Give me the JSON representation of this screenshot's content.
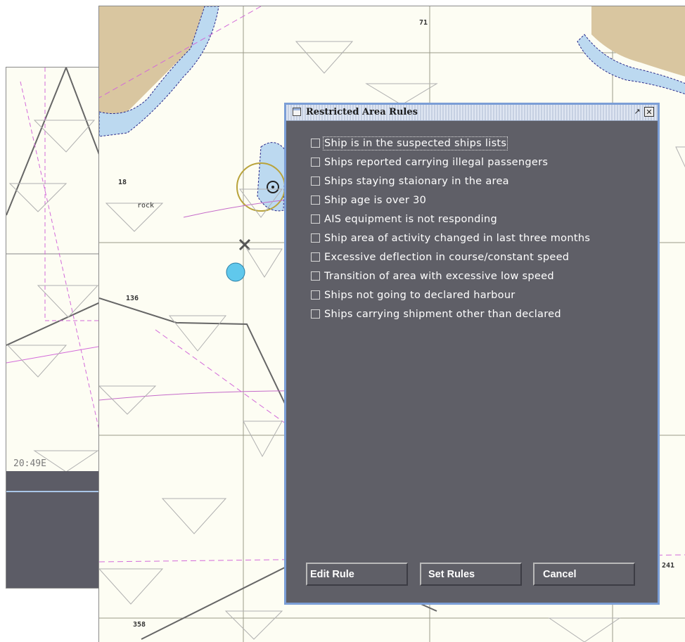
{
  "background": {
    "left_panel": {
      "coordinate_label": "20:49E"
    },
    "map": {
      "depth_labels": [
        "71",
        "136",
        "241",
        "358",
        "18",
        "rock"
      ]
    }
  },
  "dialog": {
    "title": "Restricted Area Rules",
    "icons": {
      "window": "window-icon",
      "restore": "restore-icon",
      "close": "close-icon"
    },
    "rules": [
      {
        "label": "Ship is in the suspected ships lists",
        "checked": false,
        "focused": true
      },
      {
        "label": "Ships reported carrying illegal passengers",
        "checked": false
      },
      {
        "label": "Ships staying staionary in the area",
        "checked": false
      },
      {
        "label": "Ship age is over 30",
        "checked": false
      },
      {
        "label": "AIS equipment is not responding",
        "checked": false
      },
      {
        "label": "Ship area of activity changed in last three months",
        "checked": false
      },
      {
        "label": "Excessive deflection in course/constant speed",
        "checked": false
      },
      {
        "label": "Transition of area with excessive low speed",
        "checked": false
      },
      {
        "label": "Ships not going to declared harbour",
        "checked": false
      },
      {
        "label": "Ships carrying shipment other than declared",
        "checked": false
      }
    ],
    "buttons": {
      "edit": "Edit Rule",
      "set": "Set Rules",
      "cancel": "Cancel"
    }
  },
  "colors": {
    "dialog_bg": "#5f5f67",
    "dialog_border": "#7b9ed6",
    "land": "#d9c6a0",
    "water": "#bcd9f0"
  }
}
